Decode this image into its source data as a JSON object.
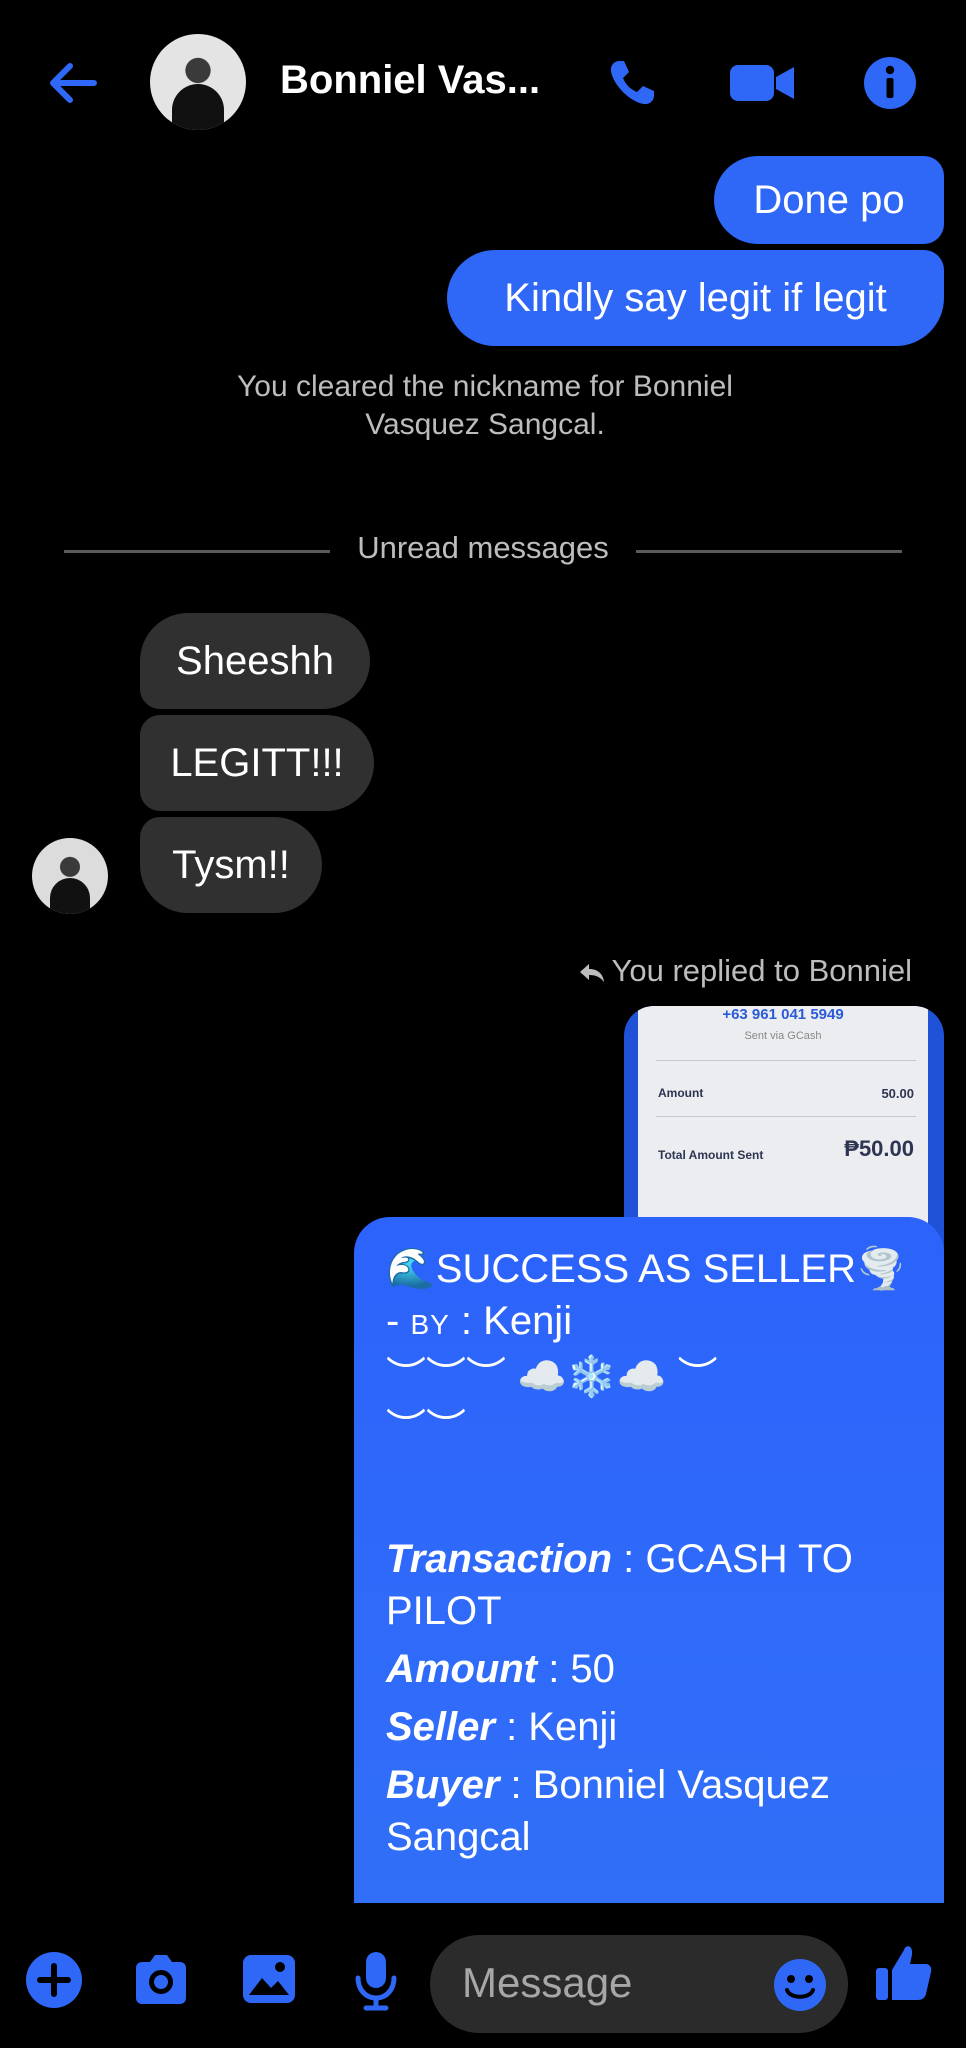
{
  "header": {
    "contact_name": "Bonniel Vas...",
    "back_icon": "back-arrow-icon",
    "call_icon": "phone-icon",
    "video_icon": "video-camera-icon",
    "info_icon": "info-icon",
    "accent_color": "#2f67f6"
  },
  "messages": {
    "sent_1": "Done po",
    "sent_2": "Kindly say legit if legit",
    "system_notice_line1": "You cleared the nickname for Bonniel",
    "system_notice_line2": "Vasquez Sangcal.",
    "unread_divider": "Unread messages",
    "received_1": "Sheeshh",
    "received_2": "LEGITT!!!",
    "received_3": "Tysm!!",
    "reply_notice": "You replied to Bonniel"
  },
  "quoted_receipt": {
    "phone": "+63 961 041 5949",
    "sent_via": "Sent via GCash",
    "amount_label": "Amount",
    "amount_value": "50.00",
    "total_label": "Total Amount Sent",
    "total_value": "₱50.00"
  },
  "big_message": {
    "line1": "🌊SUCCESS AS SELLER🌪️",
    "by_prefix": "- ",
    "by_label": "BY",
    "by_value": " : Kenji",
    "deco1": "︶︶︶ ☁️❄️☁️ ︶",
    "deco2": "︶︶",
    "transaction_label": "Transaction",
    "transaction_value": " : GCASH TO PILOT",
    "amount_label": "Amount",
    "amount_value": " : 50",
    "seller_label": "Seller",
    "seller_value": " : Kenji",
    "buyer_label": "Buyer",
    "buyer_value": " : Bonniel Vasquez Sangcal"
  },
  "composer": {
    "placeholder": "Message",
    "icons": [
      "plus-icon",
      "camera-icon",
      "gallery-icon",
      "microphone-icon",
      "emoji-icon",
      "thumbs-up-icon"
    ]
  }
}
